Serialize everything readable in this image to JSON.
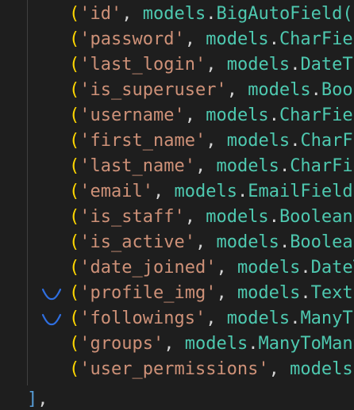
{
  "code": {
    "lines": [
      {
        "field": "'id'",
        "module": "models",
        "type": "BigAutoField(a"
      },
      {
        "field": "'password'",
        "module": "models",
        "type": "CharFiel"
      },
      {
        "field": "'last_login'",
        "module": "models",
        "type": "DateTi"
      },
      {
        "field": "'is_superuser'",
        "module": "models",
        "type": "Bool"
      },
      {
        "field": "'username'",
        "module": "models",
        "type": "CharFiel"
      },
      {
        "field": "'first_name'",
        "module": "models",
        "type": "CharFi"
      },
      {
        "field": "'last_name'",
        "module": "models",
        "type": "CharFie"
      },
      {
        "field": "'email'",
        "module": "models",
        "type": "EmailField("
      },
      {
        "field": "'is_staff'",
        "module": "models",
        "type": "BooleanF"
      },
      {
        "field": "'is_active'",
        "module": "models",
        "type": "BooleanF"
      },
      {
        "field": "'date_joined'",
        "module": "models",
        "type": "DateT"
      },
      {
        "field": "'profile_img'",
        "module": "models",
        "type": "TextF"
      },
      {
        "field": "'followings'",
        "module": "models",
        "type": "ManyTo"
      },
      {
        "field": "'groups'",
        "module": "models",
        "type": "ManyToMany"
      },
      {
        "field": "'user_permissions'",
        "module": "models",
        "type": ""
      }
    ],
    "closing_bracket": "]",
    "closing_comma": ","
  },
  "marked_lines": [
    "'profile_img'",
    "'followings'"
  ],
  "marker_icon": "chevron-down-icon",
  "colors": {
    "background": "#1e1e1e",
    "paren": "#ffd700",
    "string": "#ce9178",
    "identifier": "#4ec9b0",
    "punctuation": "#d4d4d4",
    "bracket": "#569cd6",
    "marker": "#2f6fe0"
  }
}
